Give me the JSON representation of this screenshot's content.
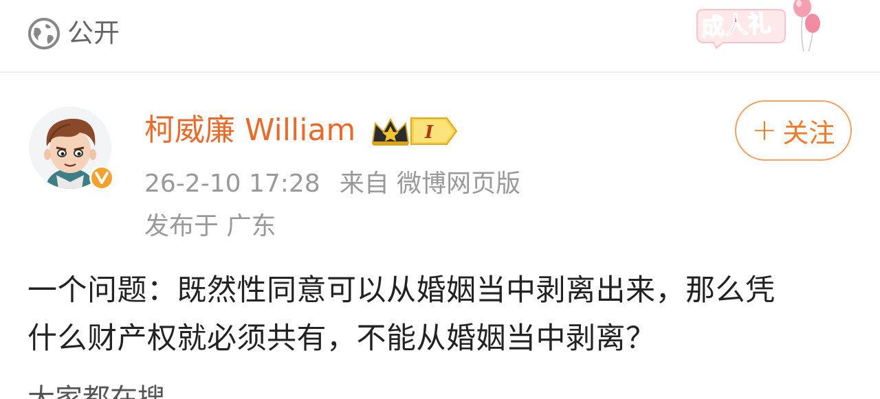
{
  "visibility": {
    "label": "公开",
    "icon": "globe-icon"
  },
  "ceremony_badge": {
    "text": "成人礼",
    "icon": "balloon-icon",
    "colors": {
      "text": "#e8667a",
      "balloon": "#f28aa0"
    }
  },
  "post": {
    "author": {
      "name": "柯威廉 William",
      "avatar_icon": "cartoon-avatar",
      "verified_icon": "verified-v-icon",
      "rank_icon": "crown-rank-icon",
      "rank_text": "I"
    },
    "follow_button": {
      "label": "关注",
      "icon": "plus-icon"
    },
    "timestamp": "26-2-10 17:28",
    "source": "来自 微博网页版",
    "location": "发布于 广东",
    "content_lines": [
      "一个问题：既然性同意可以从婚姻当中剥离出来，那么凭",
      "什么财产权就必须共有，不能从婚姻当中剥离？"
    ]
  },
  "section": {
    "title": "大家都在搜"
  },
  "colors": {
    "accent": "#e86b2b",
    "follow_border": "#f0a163",
    "muted": "#999999",
    "verified": "#f5a12d"
  }
}
